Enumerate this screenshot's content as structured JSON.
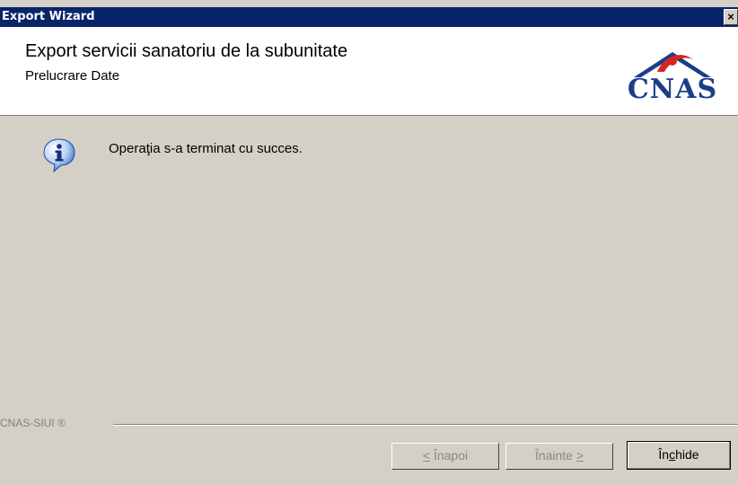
{
  "window": {
    "title": "Export Wizard",
    "close_glyph": "×"
  },
  "header": {
    "title": "Export servicii sanatoriu de la subunitate",
    "subtitle": "Prelucrare Date",
    "logo_text": "CNAS"
  },
  "content": {
    "icon": "info-icon",
    "message": "Operaţia s-a terminat cu succes."
  },
  "footer": {
    "label": "CNAS-SIUI ®"
  },
  "buttons": {
    "back": {
      "mnemonic": "<",
      "rest": " Înapoi"
    },
    "next": {
      "prefix": "Înainte ",
      "mnemonic": ">"
    },
    "close": {
      "prefix": "În",
      "mnemonic": "c",
      "rest": "hide"
    }
  },
  "colors": {
    "titlebar": "#0a246a",
    "dialog_bg": "#d4d0c8",
    "logo_blue": "#1c3e8a",
    "logo_red": "#d9231f"
  }
}
